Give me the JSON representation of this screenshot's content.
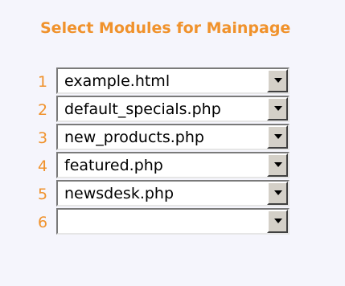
{
  "title": "Select Modules for Mainpage",
  "rows": [
    {
      "number": "1",
      "value": "example.html"
    },
    {
      "number": "2",
      "value": "default_specials.php"
    },
    {
      "number": "3",
      "value": "new_products.php"
    },
    {
      "number": "4",
      "value": "featured.php"
    },
    {
      "number": "5",
      "value": "newsdesk.php"
    },
    {
      "number": "6",
      "value": ""
    }
  ],
  "colors": {
    "accent": "#f0922c",
    "background": "#f5f5fc"
  },
  "icons": {
    "dropdown": "chevron-down-icon"
  }
}
